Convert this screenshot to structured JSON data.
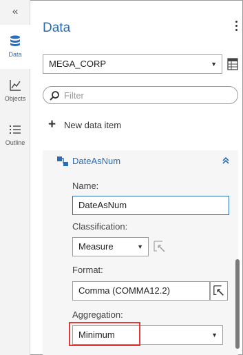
{
  "rail": {
    "collapse_glyph": "«",
    "items": [
      {
        "label": "Data",
        "icon": "database-icon",
        "active": true
      },
      {
        "label": "Objects",
        "icon": "line-chart-icon",
        "active": false
      },
      {
        "label": "Outline",
        "icon": "list-icon",
        "active": false
      }
    ]
  },
  "panel": {
    "title": "Data",
    "data_source": {
      "value": "MEGA_CORP"
    },
    "filter": {
      "placeholder": "Filter"
    },
    "new_item_label": "New data item"
  },
  "data_item": {
    "name": "DateAsNum",
    "name_label": "Name:",
    "name_value": "DateAsNum",
    "classification_label": "Classification:",
    "classification_value": "Measure",
    "format_label": "Format:",
    "format_value": "Comma (COMMA12.2)",
    "aggregation_label": "Aggregation:",
    "aggregation_value": "Minimum"
  },
  "colors": {
    "accent": "#2a6cb5",
    "highlight": "#e53935"
  }
}
